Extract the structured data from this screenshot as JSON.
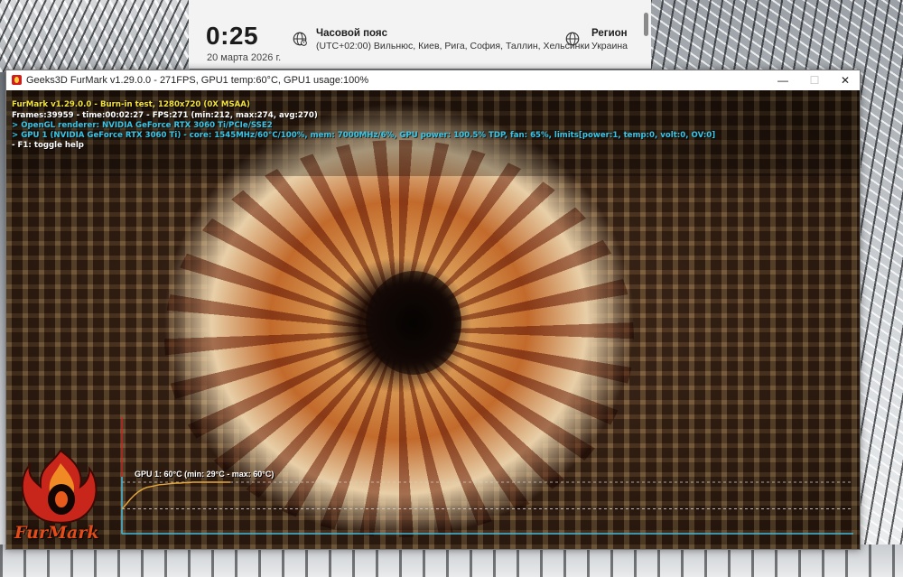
{
  "clock": {
    "time": "0:25",
    "date": "20 марта 2026 г.",
    "timezone_title": "Часовой пояс",
    "timezone_value": "(UTC+02:00) Вильнюс, Киев, Рига, София, Таллин, Хельсинки",
    "region_title": "Регион",
    "region_value": "Украина"
  },
  "window": {
    "title": "Geeks3D FurMark v1.29.0.0 - 271FPS, GPU1 temp:60°C, GPU1 usage:100%",
    "min_label": "—",
    "max_label": "☐",
    "close_label": "✕"
  },
  "hud": {
    "line1": "FurMark v1.29.0.0 - Burn-in test, 1280x720 (0X MSAA)",
    "line2": "Frames:39959 - time:00:02:27 - FPS:271 (min:212, max:274, avg:270)",
    "line3": "> OpenGL renderer: NVIDIA GeForce RTX 3060 Ti/PCIe/SSE2",
    "line4": "> GPU 1 (NVIDIA GeForce RTX 3060 Ti) - core: 1545MHz/60°C/100%, mem: 7000MHz/6%, GPU power: 100.5% TDP, fan: 65%, limits[power:1, temp:0, volt:0, OV:0]",
    "line5": "- F1: toggle help"
  },
  "logo": {
    "text": "FurMark"
  },
  "chart_data": {
    "type": "line",
    "title": "GPU 1: 60°C (min: 29°C - max: 60°C)",
    "current": 60,
    "min": 29,
    "max": 60,
    "series": [
      {
        "name": "GPU 1",
        "values": [
          29,
          34,
          40,
          45,
          49,
          52,
          54,
          55,
          56,
          57,
          57.5,
          58,
          58.5,
          59,
          59,
          59.5,
          59.5,
          60,
          60,
          60,
          60,
          60,
          60,
          60,
          60,
          60,
          60
        ]
      }
    ],
    "colors": {
      "line": "#e6a83a",
      "axis": "#3fb6d8",
      "marker": "#d61e1e",
      "guide": "#cfcfcf"
    }
  }
}
